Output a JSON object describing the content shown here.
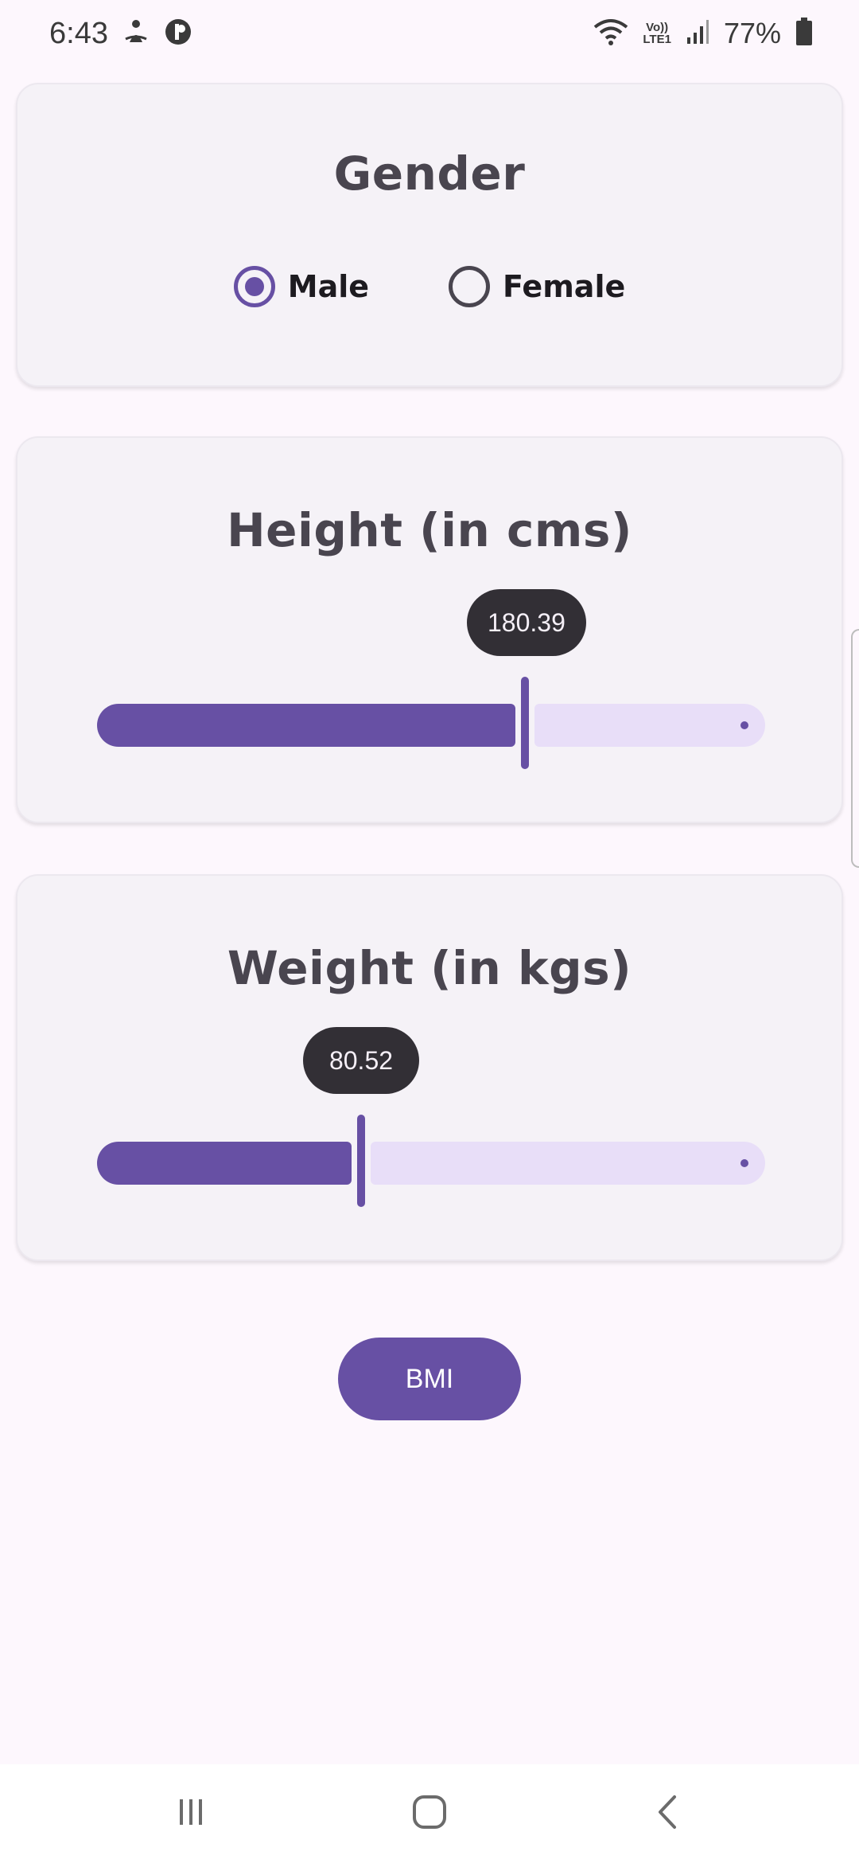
{
  "status_bar": {
    "time": "6:43",
    "network_top": "Vo))",
    "network_bottom": "LTE1",
    "battery_percent": "77%"
  },
  "gender": {
    "title": "Gender",
    "options": [
      {
        "label": "Male",
        "selected": true
      },
      {
        "label": "Female",
        "selected": false
      }
    ]
  },
  "height": {
    "title": "Height (in cms)",
    "value_label": "180.39",
    "value_fraction": 0.64
  },
  "weight": {
    "title": "Weight (in kgs)",
    "value_label": "80.52",
    "value_fraction": 0.395
  },
  "action": {
    "bmi_label": "BMI"
  },
  "colors": {
    "accent": "#6750a4",
    "track_inactive": "#e8def8",
    "bubble": "#322f35",
    "background": "#fdf7fd",
    "card": "#f5f2f7"
  },
  "icons": {
    "status_left": [
      "meditation-icon",
      "circle-app-icon"
    ],
    "status_right": [
      "wifi-icon",
      "signal-icon",
      "battery-icon"
    ],
    "nav": [
      "recent-apps-icon",
      "home-icon",
      "back-icon"
    ]
  }
}
